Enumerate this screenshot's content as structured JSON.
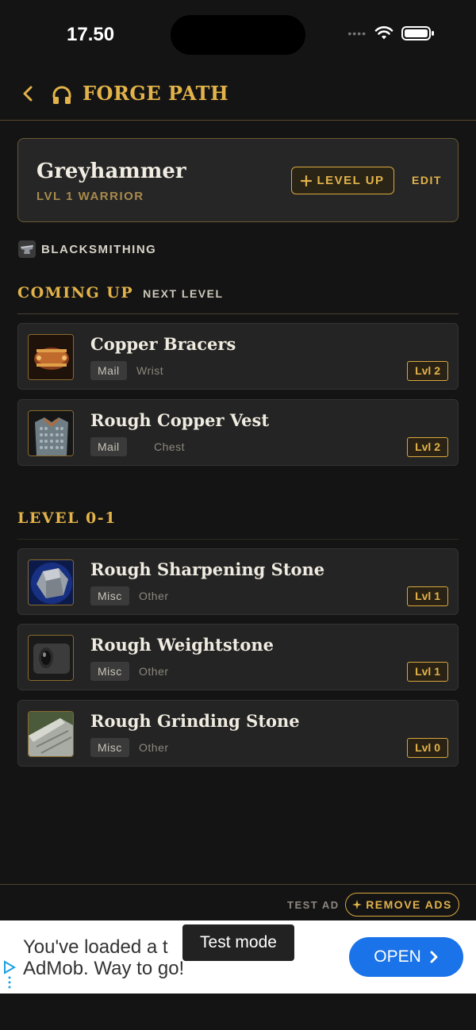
{
  "status_bar": {
    "time": "17.50"
  },
  "nav": {
    "title": "FORGE PATH"
  },
  "character": {
    "name": "Greyhammer",
    "subtitle": "LVL 1 WARRIOR",
    "level_up_label": "LEVEL UP",
    "edit_label": "EDIT"
  },
  "profession": {
    "label": "BLACKSMITHING"
  },
  "sections": [
    {
      "title": "COMING UP",
      "subtitle": "NEXT LEVEL",
      "items": [
        {
          "name": "Copper Bracers",
          "type": "Mail",
          "slot": "Wrist",
          "level": "Lvl 2",
          "icon": "copper-bracers-icon"
        },
        {
          "name": "Rough Copper Vest",
          "type": "Mail",
          "slot": "Chest",
          "level": "Lvl 2",
          "icon": "copper-vest-icon"
        }
      ]
    },
    {
      "title": "LEVEL 0-1",
      "subtitle": "",
      "items": [
        {
          "name": "Rough Sharpening Stone",
          "type": "Misc",
          "slot": "Other",
          "level": "Lvl 1",
          "icon": "sharpening-stone-icon"
        },
        {
          "name": "Rough Weightstone",
          "type": "Misc",
          "slot": "Other",
          "level": "Lvl 1",
          "icon": "weightstone-icon"
        },
        {
          "name": "Rough Grinding Stone",
          "type": "Misc",
          "slot": "Other",
          "level": "Lvl 0",
          "icon": "grinding-stone-icon"
        }
      ]
    }
  ],
  "footer": {
    "test_ad_label": "TEST AD",
    "remove_ads_label": "REMOVE ADS"
  },
  "ad": {
    "text_line1": "You've loaded a t",
    "text_line2": "AdMob. Way to go!",
    "toast": "Test mode",
    "open_label": "OPEN"
  },
  "colors": {
    "accent": "#e3b34a",
    "background": "#141414",
    "card": "#242424",
    "ad_button": "#1a73e8"
  }
}
